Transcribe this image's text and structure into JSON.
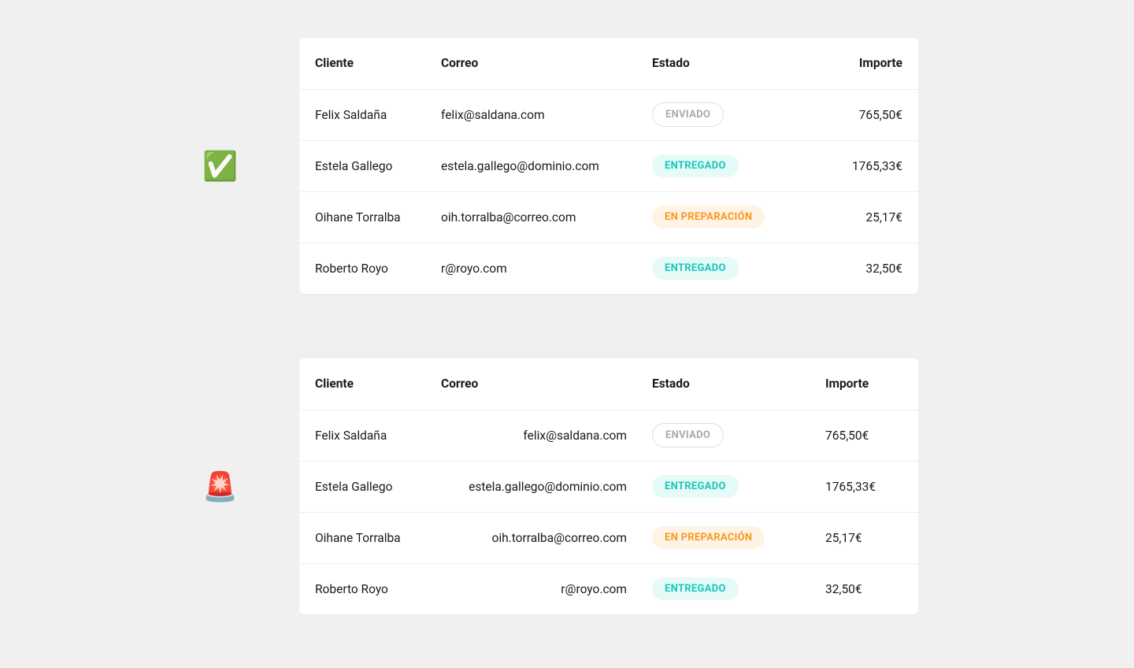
{
  "good_icon": "✅",
  "bad_icon": "🚨",
  "headers": {
    "client": "Cliente",
    "email": "Correo",
    "status": "Estado",
    "amount": "Importe"
  },
  "rows": [
    {
      "client": "Felix Saldaña",
      "email": "felix@saldana.com",
      "status": "ENVIADO",
      "status_class": "badge-enviado",
      "amount": "765,50€"
    },
    {
      "client": "Estela Gallego",
      "email": "estela.gallego@dominio.com",
      "status": "ENTREGADO",
      "status_class": "badge-entregado",
      "amount": "1765,33€"
    },
    {
      "client": "Oihane Torralba",
      "email": "oih.torralba@correo.com",
      "status": "EN PREPARACIÓN",
      "status_class": "badge-preparacion",
      "amount": "25,17€"
    },
    {
      "client": "Roberto Royo",
      "email": "r@royo.com",
      "status": "ENTREGADO",
      "status_class": "badge-entregado",
      "amount": "32,50€"
    }
  ]
}
